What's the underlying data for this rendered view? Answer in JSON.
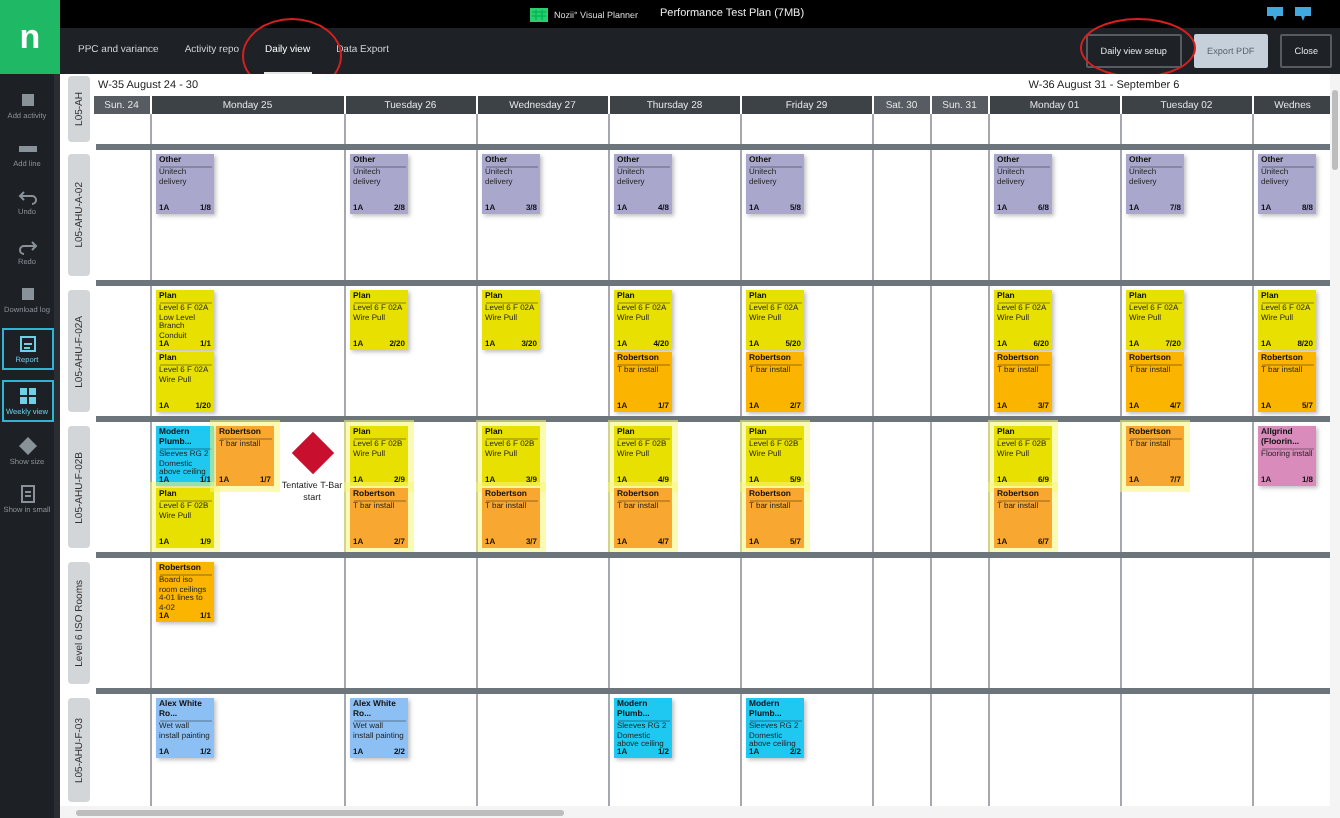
{
  "app": {
    "logo": "n",
    "brand": "Nozii° Visual Planner",
    "title": "Performance Test Plan (7MB)"
  },
  "sidebar": {
    "items": [
      {
        "label": "Add activity",
        "active": false
      },
      {
        "label": "Add line",
        "active": false
      },
      {
        "label": "Undo",
        "active": false
      },
      {
        "label": "Redo",
        "active": false
      },
      {
        "label": "Download log",
        "active": false
      },
      {
        "label": "Report",
        "active": true
      },
      {
        "label": "Weekly view",
        "active": true
      },
      {
        "label": "Show size",
        "active": false
      },
      {
        "label": "Show in small",
        "active": false
      }
    ]
  },
  "tabs": [
    {
      "label": "PPC and variance",
      "selected": false
    },
    {
      "label": "Activity repo",
      "selected": false
    },
    {
      "label": "Daily view",
      "selected": true
    },
    {
      "label": "Data Export",
      "selected": false
    }
  ],
  "buttons": [
    {
      "label": "Daily view setup",
      "kind": "dark"
    },
    {
      "label": "Export PDF",
      "kind": "light"
    },
    {
      "label": "Close",
      "kind": "dark"
    }
  ],
  "board": {
    "corner_label": "L05-AH",
    "weeks": [
      {
        "label": "W-35 August 24 - 30",
        "kind": "left"
      },
      {
        "label": "W-36 August 31 - September 6",
        "kind": "center"
      }
    ],
    "days": [
      {
        "label": "Sun. 24",
        "weekend": true
      },
      {
        "label": "Monday 25",
        "weekend": false
      },
      {
        "label": "Tuesday 26",
        "weekend": false
      },
      {
        "label": "Wednesday 27",
        "weekend": false
      },
      {
        "label": "Thursday 28",
        "weekend": false
      },
      {
        "label": "Friday 29",
        "weekend": false
      },
      {
        "label": "Sat. 30",
        "weekend": true
      },
      {
        "label": "Sun. 31",
        "weekend": true
      },
      {
        "label": "Monday 01",
        "weekend": false
      },
      {
        "label": "Tuesday 02",
        "weekend": false
      },
      {
        "label": "Wednes",
        "weekend": false
      }
    ],
    "rows": [
      {
        "label": "L05-AHU-A-02",
        "cells": [
          {},
          {
            "stacks": [
              [
                {
                  "kind": "card",
                  "title": "Other",
                  "body": "Unitech delivery",
                  "crew": "1A",
                  "count": "1/8",
                  "color": "#a9a8cc",
                  "highlighted": false
                }
              ]
            ]
          },
          {
            "stacks": [
              [
                {
                  "kind": "card",
                  "title": "Other",
                  "body": "Unitech delivery",
                  "crew": "1A",
                  "count": "2/8",
                  "color": "#a9a8cc",
                  "highlighted": false
                }
              ]
            ]
          },
          {
            "stacks": [
              [
                {
                  "kind": "card",
                  "title": "Other",
                  "body": "Unitech delivery",
                  "crew": "1A",
                  "count": "3/8",
                  "color": "#a9a8cc",
                  "highlighted": false
                }
              ]
            ]
          },
          {
            "stacks": [
              [
                {
                  "kind": "card",
                  "title": "Other",
                  "body": "Unitech delivery",
                  "crew": "1A",
                  "count": "4/8",
                  "color": "#a9a8cc",
                  "highlighted": false
                }
              ]
            ]
          },
          {
            "stacks": [
              [
                {
                  "kind": "card",
                  "title": "Other",
                  "body": "Unitech delivery",
                  "crew": "1A",
                  "count": "5/8",
                  "color": "#a9a8cc",
                  "highlighted": false
                }
              ]
            ]
          },
          {},
          {},
          {
            "stacks": [
              [
                {
                  "kind": "card",
                  "title": "Other",
                  "body": "Unitech delivery",
                  "crew": "1A",
                  "count": "6/8",
                  "color": "#a9a8cc",
                  "highlighted": false
                }
              ]
            ]
          },
          {
            "stacks": [
              [
                {
                  "kind": "card",
                  "title": "Other",
                  "body": "Unitech delivery",
                  "crew": "1A",
                  "count": "7/8",
                  "color": "#a9a8cc",
                  "highlighted": false
                }
              ]
            ]
          },
          {
            "stacks": [
              [
                {
                  "kind": "card",
                  "title": "Other",
                  "body": "Unitech delivery",
                  "crew": "1A",
                  "count": "8/8",
                  "color": "#a9a8cc",
                  "highlighted": false
                }
              ]
            ]
          }
        ]
      },
      {
        "label": "L05-AHU-F-02A",
        "cells": [
          {},
          {
            "stacks": [
              [
                {
                  "kind": "card",
                  "title": "Plan",
                  "body": "Level 6 F 02A Low Level Branch Conduit",
                  "crew": "1A",
                  "count": "1/1",
                  "color": "#e8e000",
                  "highlighted": false
                },
                {
                  "kind": "card",
                  "title": "Plan",
                  "body": "Level 6 F 02A Wire Pull",
                  "crew": "1A",
                  "count": "1/20",
                  "color": "#e8e000",
                  "highlighted": false
                }
              ]
            ]
          },
          {
            "stacks": [
              [
                {
                  "kind": "card",
                  "title": "Plan",
                  "body": "Level 6 F 02A Wire Pull",
                  "crew": "1A",
                  "count": "2/20",
                  "color": "#e8e000",
                  "highlighted": false
                }
              ]
            ]
          },
          {
            "stacks": [
              [
                {
                  "kind": "card",
                  "title": "Plan",
                  "body": "Level 6 F 02A Wire Pull",
                  "crew": "1A",
                  "count": "3/20",
                  "color": "#e8e000",
                  "highlighted": false
                }
              ]
            ]
          },
          {
            "stacks": [
              [
                {
                  "kind": "card",
                  "title": "Plan",
                  "body": "Level 6 F 02A Wire Pull",
                  "crew": "1A",
                  "count": "4/20",
                  "color": "#e8e000",
                  "highlighted": false
                },
                {
                  "kind": "card",
                  "title": "Robertson",
                  "body": "T bar install",
                  "crew": "1A",
                  "count": "1/7",
                  "color": "#fbb400",
                  "highlighted": false
                }
              ]
            ]
          },
          {
            "stacks": [
              [
                {
                  "kind": "card",
                  "title": "Plan",
                  "body": "Level 6 F 02A Wire Pull",
                  "crew": "1A",
                  "count": "5/20",
                  "color": "#e8e000",
                  "highlighted": false
                },
                {
                  "kind": "card",
                  "title": "Robertson",
                  "body": "T bar install",
                  "crew": "1A",
                  "count": "2/7",
                  "color": "#fbb400",
                  "highlighted": false
                }
              ]
            ]
          },
          {},
          {},
          {
            "stacks": [
              [
                {
                  "kind": "card",
                  "title": "Plan",
                  "body": "Level 6 F 02A Wire Pull",
                  "crew": "1A",
                  "count": "6/20",
                  "color": "#e8e000",
                  "highlighted": false
                },
                {
                  "kind": "card",
                  "title": "Robertson",
                  "body": "T bar install",
                  "crew": "1A",
                  "count": "3/7",
                  "color": "#fbb400",
                  "highlighted": false
                }
              ]
            ]
          },
          {
            "stacks": [
              [
                {
                  "kind": "card",
                  "title": "Plan",
                  "body": "Level 6 F 02A Wire Pull",
                  "crew": "1A",
                  "count": "7/20",
                  "color": "#e8e000",
                  "highlighted": false
                },
                {
                  "kind": "card",
                  "title": "Robertson",
                  "body": "T bar install",
                  "crew": "1A",
                  "count": "4/7",
                  "color": "#fbb400",
                  "highlighted": false
                }
              ]
            ]
          },
          {
            "stacks": [
              [
                {
                  "kind": "card",
                  "title": "Plan",
                  "body": "Level 6 F 02A Wire Pull",
                  "crew": "1A",
                  "count": "8/20",
                  "color": "#e8e000",
                  "highlighted": false
                },
                {
                  "kind": "card",
                  "title": "Robertson",
                  "body": "T bar install",
                  "crew": "1A",
                  "count": "5/7",
                  "color": "#fbb400",
                  "highlighted": false
                }
              ]
            ]
          }
        ]
      },
      {
        "label": "L05-AHU-F-02B",
        "cells": [
          {},
          {
            "stacks": [
              [
                {
                  "kind": "card",
                  "title": "Modern Plumb...",
                  "body": "Sleeves RG 2 Domestic above ceiling",
                  "crew": "1A",
                  "count": "1/1",
                  "color": "#1ec8f0",
                  "highlighted": false
                },
                {
                  "kind": "card",
                  "title": "Plan",
                  "body": "Level 6 F 02B Wire Pull",
                  "crew": "1A",
                  "count": "1/9",
                  "color": "#e8e000",
                  "highlighted": true
                }
              ],
              [
                {
                  "kind": "card",
                  "title": "Robertson",
                  "body": "T bar install",
                  "crew": "1A",
                  "count": "1/7",
                  "color": "#f8a830",
                  "highlighted": true
                }
              ],
              [
                {
                  "kind": "milestone",
                  "label": "Tentative T-Bar start",
                  "color": "#c8102e"
                }
              ]
            ]
          },
          {
            "stacks": [
              [
                {
                  "kind": "card",
                  "title": "Plan",
                  "body": "Level 6 F 02B Wire Pull",
                  "crew": "1A",
                  "count": "2/9",
                  "color": "#e8e000",
                  "highlighted": true
                },
                {
                  "kind": "card",
                  "title": "Robertson",
                  "body": "T bar install",
                  "crew": "1A",
                  "count": "2/7",
                  "color": "#f8a830",
                  "highlighted": true
                }
              ]
            ]
          },
          {
            "stacks": [
              [
                {
                  "kind": "card",
                  "title": "Plan",
                  "body": "Level 6 F 02B Wire Pull",
                  "crew": "1A",
                  "count": "3/9",
                  "color": "#e8e000",
                  "highlighted": true
                },
                {
                  "kind": "card",
                  "title": "Robertson",
                  "body": "T bar install",
                  "crew": "1A",
                  "count": "3/7",
                  "color": "#f8a830",
                  "highlighted": true
                }
              ]
            ]
          },
          {
            "stacks": [
              [
                {
                  "kind": "card",
                  "title": "Plan",
                  "body": "Level 6 F 02B Wire Pull",
                  "crew": "1A",
                  "count": "4/9",
                  "color": "#e8e000",
                  "highlighted": true
                },
                {
                  "kind": "card",
                  "title": "Robertson",
                  "body": "T bar install",
                  "crew": "1A",
                  "count": "4/7",
                  "color": "#f8a830",
                  "highlighted": true
                }
              ]
            ]
          },
          {
            "stacks": [
              [
                {
                  "kind": "card",
                  "title": "Plan",
                  "body": "Level 6 F 02B Wire Pull",
                  "crew": "1A",
                  "count": "5/9",
                  "color": "#e8e000",
                  "highlighted": true
                },
                {
                  "kind": "card",
                  "title": "Robertson",
                  "body": "T bar install",
                  "crew": "1A",
                  "count": "5/7",
                  "color": "#f8a830",
                  "highlighted": true
                }
              ]
            ]
          },
          {},
          {},
          {
            "stacks": [
              [
                {
                  "kind": "card",
                  "title": "Plan",
                  "body": "Level 6 F 02B Wire Pull",
                  "crew": "1A",
                  "count": "6/9",
                  "color": "#e8e000",
                  "highlighted": true
                },
                {
                  "kind": "card",
                  "title": "Robertson",
                  "body": "T bar install",
                  "crew": "1A",
                  "count": "6/7",
                  "color": "#f8a830",
                  "highlighted": true
                }
              ]
            ]
          },
          {
            "stacks": [
              [
                {
                  "kind": "card",
                  "title": "Robertson",
                  "body": "T bar install",
                  "crew": "1A",
                  "count": "7/7",
                  "color": "#f8a830",
                  "highlighted": true
                }
              ]
            ]
          },
          {
            "stacks": [
              [
                {
                  "kind": "card",
                  "title": "Allgrind (Floorin...",
                  "body": "Flooring install",
                  "crew": "1A",
                  "count": "1/8",
                  "color": "#d98cbc",
                  "highlighted": false
                }
              ]
            ]
          }
        ]
      },
      {
        "label": "Level 6 ISO Rooms",
        "cells": [
          {},
          {
            "stacks": [
              [
                {
                  "kind": "card",
                  "title": "Robertson",
                  "body": "Board iso room ceilings 4-01 lines to 4-02",
                  "crew": "1A",
                  "count": "1/1",
                  "color": "#fbb400",
                  "highlighted": false
                }
              ]
            ]
          },
          {},
          {},
          {},
          {},
          {},
          {},
          {},
          {},
          {}
        ]
      },
      {
        "label": "L05-AHU-F-03",
        "cells": [
          {},
          {
            "stacks": [
              [
                {
                  "kind": "card",
                  "title": "Alex White Ro...",
                  "body": "Wet wall install painting",
                  "crew": "1A",
                  "count": "1/2",
                  "color": "#8cc0f4",
                  "highlighted": false
                }
              ]
            ]
          },
          {
            "stacks": [
              [
                {
                  "kind": "card",
                  "title": "Alex White Ro...",
                  "body": "Wet wall install painting",
                  "crew": "1A",
                  "count": "2/2",
                  "color": "#8cc0f4",
                  "highlighted": false
                }
              ]
            ]
          },
          {},
          {
            "stacks": [
              [
                {
                  "kind": "card",
                  "title": "Modern Plumb...",
                  "body": "Sleeves RG 2 Domestic above ceiling",
                  "crew": "1A",
                  "count": "1/2",
                  "color": "#1ec8f0",
                  "highlighted": false
                }
              ]
            ]
          },
          {
            "stacks": [
              [
                {
                  "kind": "card",
                  "title": "Modern Plumb...",
                  "body": "Sleeves RG 2 Domestic above ceiling",
                  "crew": "1A",
                  "count": "2/2",
                  "color": "#1ec8f0",
                  "highlighted": false
                }
              ]
            ]
          },
          {},
          {},
          {},
          {},
          {}
        ]
      }
    ]
  }
}
